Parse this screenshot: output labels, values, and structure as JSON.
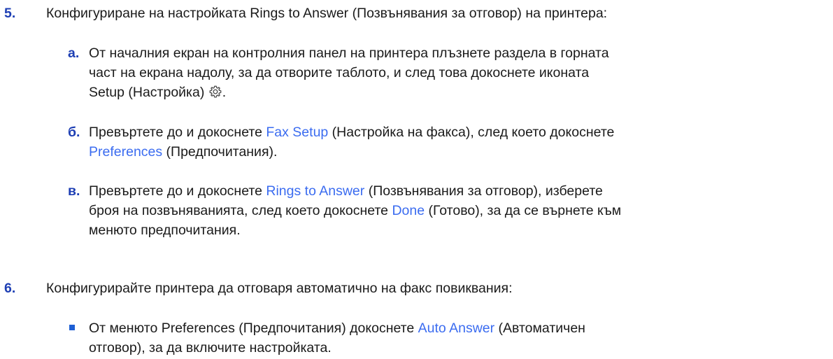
{
  "step5": {
    "num": "5.",
    "text": "Конфигуриране на настройката Rings to Answer (Позвънявания за отговор) на принтера:"
  },
  "step5a": {
    "num": "a.",
    "line1": "От началния екран на контролния панел на принтера плъзнете раздела в горната",
    "line2": "част на екрана надолу, за да отворите таблото, и след това докоснете иконата",
    "line3": "Setup (Настройка)",
    "line3_end": ".",
    "icon": "gear-icon"
  },
  "step5b": {
    "num": "б.",
    "pre": "Превъртете до и докоснете ",
    "link1": "Fax Setup",
    "mid": " (Настройка на факса), след което докоснете",
    "link2": "Preferences",
    "post": " (Предпочитания)."
  },
  "step5c": {
    "num": "в.",
    "pre": "Превъртете до и докоснете ",
    "link1": "Rings to Answer",
    "mid": " (Позвънявания за отговор), изберете",
    "line2_pre": "броя на позвъняванията, след което докоснете ",
    "link2": "Done",
    "line2_post": " (Готово), за да се върнете към",
    "line3": "менюто предпочитания."
  },
  "step6": {
    "num": "6.",
    "text": "Конфигурирайте принтера да отговаря автоматично на факс повиквания:"
  },
  "step6bullet": {
    "pre": "От менюто Preferences (Предпочитания) докоснете ",
    "link": "Auto Answer",
    "post": " (Автоматичен",
    "line2": "отговор), за да включите настройката."
  },
  "colors": {
    "number": "#1e3fb4",
    "link": "#3b6cf0",
    "bullet": "#1e5fd4",
    "text": "#1a1a1a"
  }
}
